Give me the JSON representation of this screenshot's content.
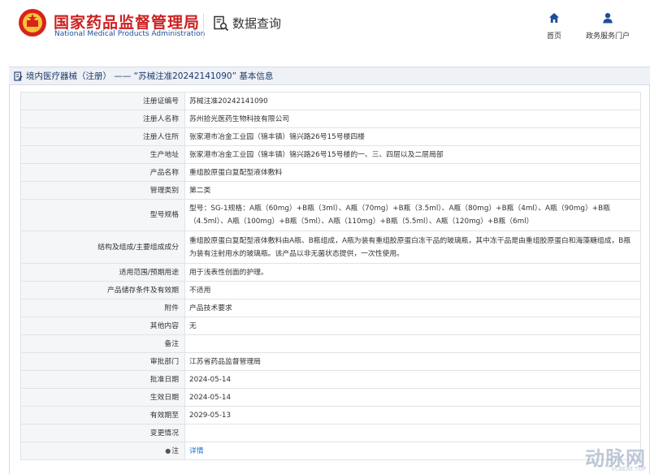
{
  "header": {
    "org_name_cn": "国家药品监督管理局",
    "org_name_en": "National Medical Products Administration",
    "query_title": "数据查询",
    "nav": [
      {
        "label": "首页",
        "icon": "home-icon"
      },
      {
        "label": "政务服务门户",
        "icon": "user-icon"
      }
    ]
  },
  "breadcrumb": "境内医疗器械（注册） —— “苏械注准20242141090” 基本信息",
  "records": [
    {
      "key": "注册证编号",
      "value": "苏械注准20242141090"
    },
    {
      "key": "注册人名称",
      "value": "苏州拾光医药生物科技有限公司"
    },
    {
      "key": "注册人住所",
      "value": "张家港市冶金工业园（锦丰镇）锦兴路26号15号楼四楼"
    },
    {
      "key": "生产地址",
      "value": "张家港市冶金工业园（锦丰镇）锦兴路26号15号楼的一、三、四层以及二层局部"
    },
    {
      "key": "产品名称",
      "value": "重组胶原蛋白复配型液体敷料"
    },
    {
      "key": "管理类别",
      "value": "第二类"
    },
    {
      "key": "型号规格",
      "value": "型号：SG-1规格：A瓶（60mg）+B瓶（3ml）、A瓶（70mg）+B瓶（3.5ml）、A瓶（80mg）+B瓶（4ml）、A瓶（90mg）+B瓶（4.5ml）、A瓶（100mg）+B瓶（5ml）、A瓶（110mg）+B瓶（5.5ml）、A瓶（120mg）+B瓶（6ml）"
    },
    {
      "key": "结构及组成/主要组成成分",
      "value": "重组胶原蛋白复配型液体敷料由A瓶、B瓶组成，A瓶为装有重组胶原蛋白冻干品的玻璃瓶，其中冻干品是由重组胶原蛋白和海藻糖组成，B瓶为装有注射用水的玻璃瓶。该产品以非无菌状态提供，一次性使用。"
    },
    {
      "key": "适用范围/预期用途",
      "value": "用于浅表性创面的护理。"
    },
    {
      "key": "产品储存条件及有效期",
      "value": "不适用"
    },
    {
      "key": "附件",
      "value": "产品技术要求"
    },
    {
      "key": "其他内容",
      "value": "无"
    },
    {
      "key": "备注",
      "value": ""
    },
    {
      "key": "审批部门",
      "value": "江苏省药品监督管理局"
    },
    {
      "key": "批准日期",
      "value": "2024-05-14"
    },
    {
      "key": "生效日期",
      "value": "2024-05-14"
    },
    {
      "key": "有效期至",
      "value": "2029-05-13"
    },
    {
      "key": "变更情况",
      "value": ""
    }
  ],
  "note_row": {
    "key": "注",
    "link": "详情"
  },
  "watermark": {
    "text": "动脉网",
    "sub": "VCBEAT.TOP"
  },
  "colors": {
    "brand_red": "#cc1f1f",
    "brand_blue": "#1f4f9a",
    "link": "#1a6fd4"
  }
}
